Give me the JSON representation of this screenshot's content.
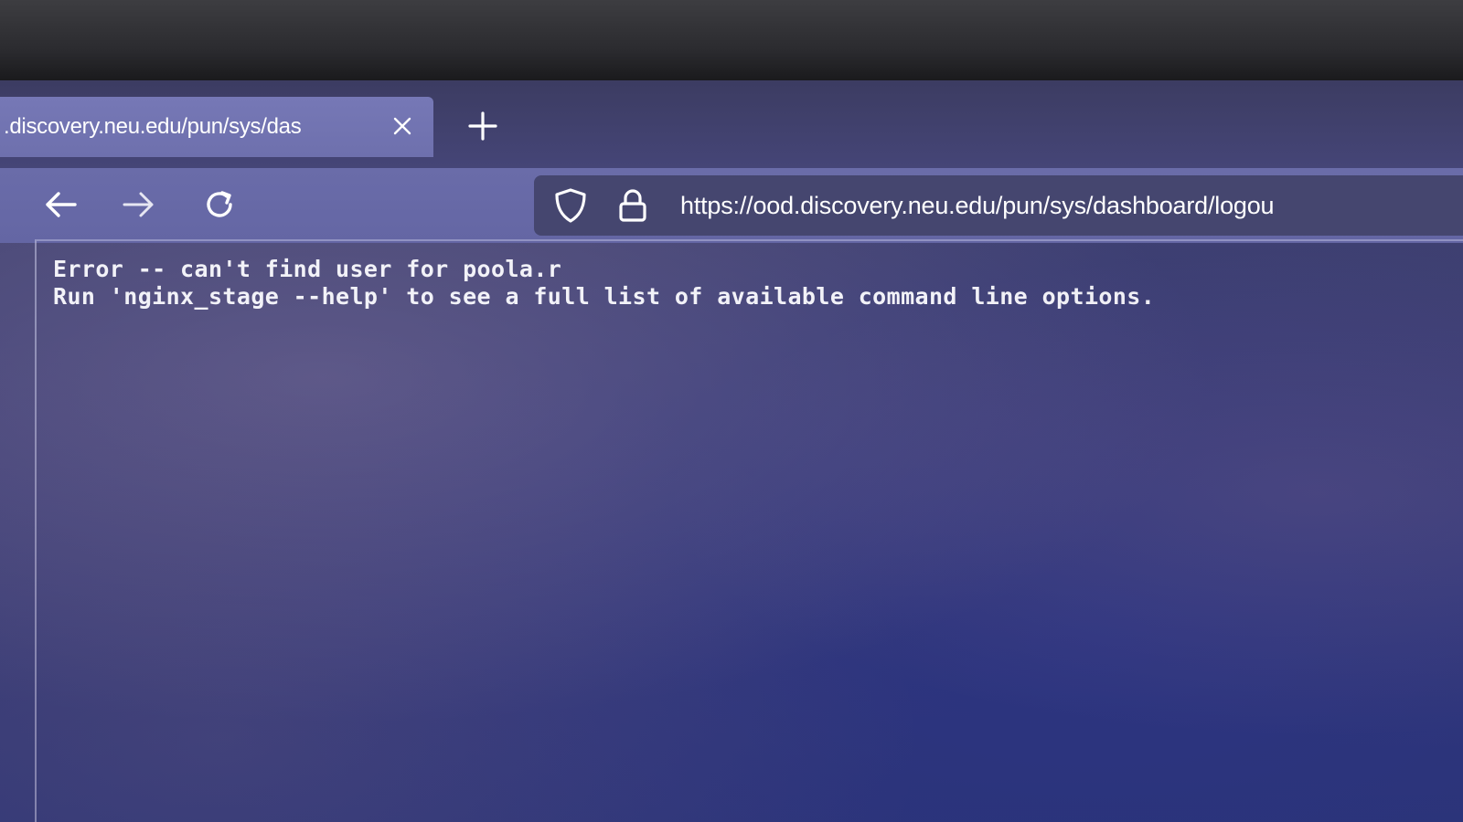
{
  "browser": {
    "tab": {
      "title": ".discovery.neu.edu/pun/sys/das",
      "close_icon": "close-icon"
    },
    "new_tab_icon": "plus-icon",
    "nav": {
      "back_icon": "arrow-left-icon",
      "forward_icon": "arrow-right-icon",
      "reload_icon": "reload-icon"
    },
    "urlbar": {
      "shield_icon": "shield-icon",
      "lock_icon": "lock-icon",
      "url": "https://ood.discovery.neu.edu/pun/sys/dashboard/logou"
    }
  },
  "page": {
    "lines": [
      "Error -- can't find user for poola.r",
      "Run 'nginx_stage --help' to see a full list of available command line options."
    ]
  },
  "colors": {
    "tab_active": "#7678b6",
    "toolbar": "#6a6ca9",
    "urlbar": "#45466f",
    "page_background": "#3a3c72",
    "text": "#f2f2f8"
  }
}
